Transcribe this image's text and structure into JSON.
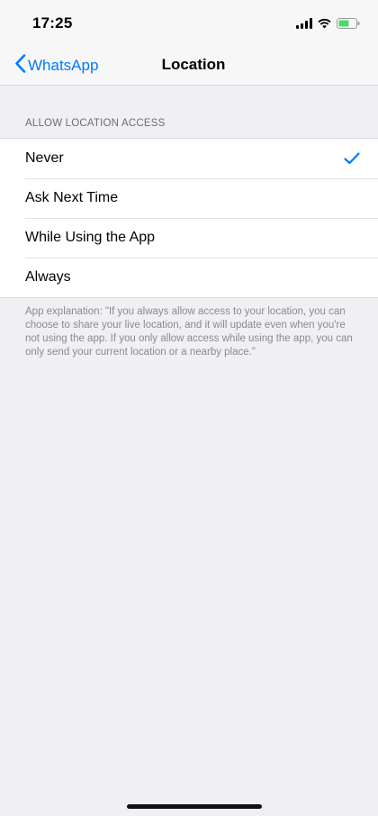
{
  "status_bar": {
    "time": "17:25",
    "icons": [
      "cellular-signal-icon",
      "wifi-icon",
      "battery-icon"
    ],
    "battery_color": "#4cd964"
  },
  "nav": {
    "back_label": "WhatsApp",
    "title": "Location",
    "accent_color": "#007aff"
  },
  "section": {
    "header": "ALLOW LOCATION ACCESS",
    "options": [
      {
        "label": "Never",
        "selected": true
      },
      {
        "label": "Ask Next Time",
        "selected": false
      },
      {
        "label": "While Using the App",
        "selected": false
      },
      {
        "label": "Always",
        "selected": false
      }
    ],
    "footer": "App explanation: \"If you always allow access to your location, you can choose to share your live location, and it will update even when you're not using the app. If you only allow access while using the app, you can only send your current location or a nearby place.\""
  }
}
